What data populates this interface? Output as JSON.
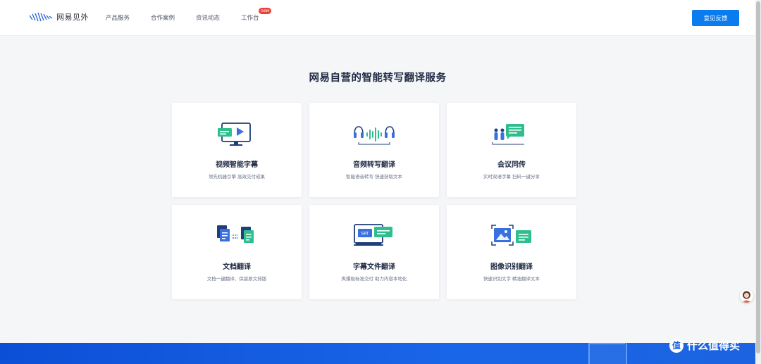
{
  "header": {
    "logo_text": "网易见外",
    "nav": [
      {
        "label": "产品服务"
      },
      {
        "label": "合作案例"
      },
      {
        "label": "资讯动态"
      },
      {
        "label": "工作台",
        "badge": "new"
      }
    ],
    "feedback_label": "意见反馈"
  },
  "main": {
    "title": "网易自营的智能转写翻译服务",
    "cards": [
      {
        "icon": "video-subtitle-icon",
        "title": "视频智能字幕",
        "desc": "领先机器引擎 高效交付成果"
      },
      {
        "icon": "audio-transcribe-icon",
        "title": "音频转写翻译",
        "desc": "智能语音转写 快速获取文本"
      },
      {
        "icon": "meeting-interpret-icon",
        "title": "会议同传",
        "desc": "实时双语字幕 扫码一键分享"
      },
      {
        "icon": "document-translate-icon",
        "title": "文档翻译",
        "desc": "文档一键翻译、保留原文排版"
      },
      {
        "icon": "subtitle-file-icon",
        "title": "字幕文件翻译",
        "desc": "爽爆极标准交付 助力内容本地化"
      },
      {
        "icon": "image-ocr-icon",
        "title": "图像识别翻译",
        "desc": "快速识别文字 精准翻译文本"
      }
    ],
    "srt_label": "SRT"
  },
  "watermark": {
    "circle": "值",
    "text": "什么值得买"
  },
  "colors": {
    "accent": "#0a7cf0",
    "icon_blue": "#3a6fe0",
    "icon_green": "#2fbf8f",
    "icon_navy": "#1f3f7a"
  }
}
